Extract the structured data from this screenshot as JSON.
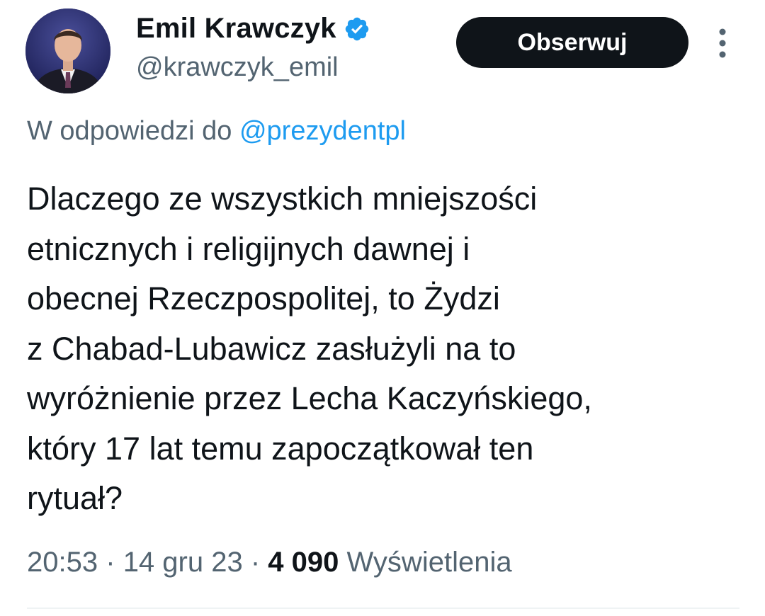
{
  "author": {
    "display_name": "Emil Krawczyk",
    "handle": "@krawczyk_emil",
    "verified": true,
    "verified_color": "#1d9bf0"
  },
  "actions": {
    "follow_label": "Obserwuj"
  },
  "reply": {
    "prefix": "W odpowiedzi do",
    "mention": "@prezydentpl"
  },
  "tweet": {
    "lines": [
      "Dlaczego ze wszystkich mniejszości",
      "etnicznych i religijnych dawnej i",
      "obecnej Rzeczpospolitej, to Żydzi",
      "z Chabad-Lubawicz zasłużyli na to",
      "wyróżnienie przez Lecha Kaczyńskiego,",
      "który 17 lat temu zapoczątkował ten",
      "rytuał?"
    ]
  },
  "meta": {
    "time": "20:53",
    "separator": "·",
    "date": "14 gru 23",
    "views_count": "4 090",
    "views_label": "Wyświetlenia"
  },
  "colors": {
    "text": "#0f1419",
    "secondary": "#536471",
    "link": "#1d9bf0",
    "button_bg": "#0f1419"
  },
  "icons": {
    "verified": "verified-badge-icon",
    "more": "more-vertical-icon"
  }
}
